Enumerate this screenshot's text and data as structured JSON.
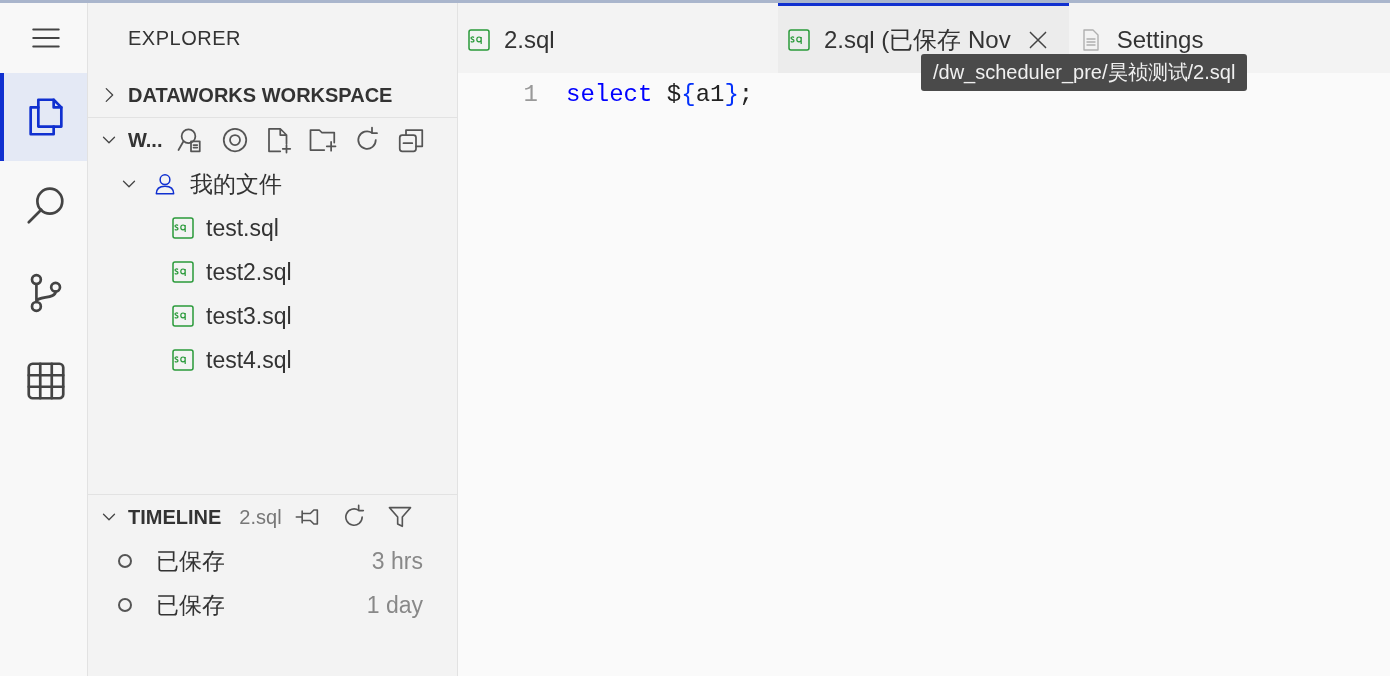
{
  "activity_bar": [
    {
      "kind": "menu",
      "selected": false
    },
    {
      "kind": "files",
      "selected": true
    },
    {
      "kind": "search",
      "selected": false
    },
    {
      "kind": "branch",
      "selected": false
    },
    {
      "kind": "table",
      "selected": false
    }
  ],
  "sidebar": {
    "title": "EXPLORER",
    "sections": [
      {
        "title": "DATAWORKS WORKSPACE",
        "expanded": false
      },
      {
        "title": "W...",
        "expanded": true,
        "tree": [
          {
            "label": "我的文件",
            "kind": "user",
            "expanded": true,
            "children": [
              {
                "label": "test.sql",
                "kind": "sql"
              },
              {
                "label": "test2.sql",
                "kind": "sql"
              },
              {
                "label": "test3.sql",
                "kind": "sql"
              },
              {
                "label": "test4.sql",
                "kind": "sql"
              }
            ]
          }
        ]
      }
    ],
    "timeline": {
      "title": "TIMELINE",
      "file": "2.sql",
      "expanded": true,
      "entries": [
        {
          "label": "已保存",
          "time": "3 hrs"
        },
        {
          "label": "已保存",
          "time": "1 day"
        }
      ]
    }
  },
  "tabs": [
    {
      "label": "2.sql",
      "kind": "sql",
      "selected": false
    },
    {
      "label": "2.sql (已保存 Nov",
      "kind": "sql",
      "selected": true
    },
    {
      "label": "Settings",
      "kind": "file",
      "selected": false
    }
  ],
  "tooltip": {
    "text": "/dw_scheduler_pre/昊祯测试/2.sql"
  },
  "editor": {
    "lines": [
      {
        "number": "1",
        "tokens": [
          {
            "text": "select",
            "kind": "keyword"
          },
          {
            "text": " $",
            "kind": "plain"
          },
          {
            "text": "{",
            "kind": "brace"
          },
          {
            "text": "a1",
            "kind": "plain"
          },
          {
            "text": "}",
            "kind": "brace"
          },
          {
            "text": ";",
            "kind": "plain"
          }
        ]
      }
    ]
  }
}
